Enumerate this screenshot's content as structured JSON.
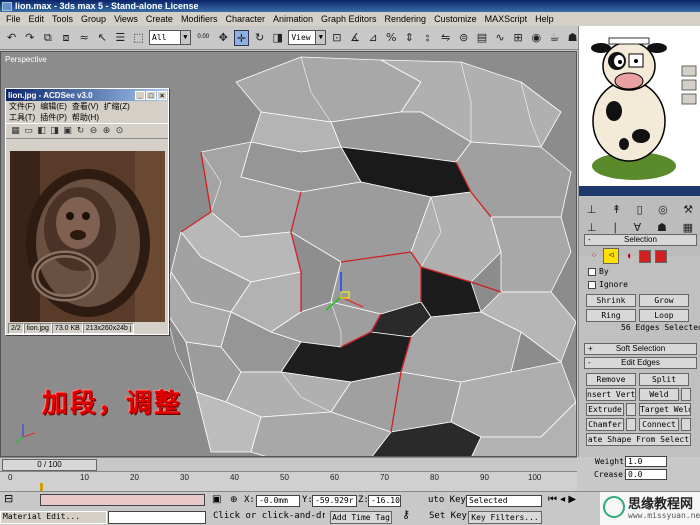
{
  "window": {
    "title": "lion.max - 3ds max 5 - Stand-alone License"
  },
  "menu": [
    "File",
    "Edit",
    "Tools",
    "Group",
    "Views",
    "Create",
    "Modifiers",
    "Character",
    "Animation",
    "Graph Editors",
    "Rendering",
    "Customize",
    "MAXScript",
    "Help"
  ],
  "toolbar": {
    "selection_filter": "All",
    "mini_value": "0.00",
    "reference_coord": "View",
    "active_tool": "move"
  },
  "viewport": {
    "label": "Perspective"
  },
  "acdsee": {
    "title": "lion.jpg - ACDSee v3.0",
    "menu_row1": [
      "文件(F)",
      "编辑(E)",
      "查看(V)",
      "扩缩(Z)"
    ],
    "menu_row2": [
      "工具(T)",
      "插件(P)",
      "帮助(H)"
    ],
    "status": {
      "index": "2/2",
      "filename": "lion.jpg",
      "size": "73.0 KB",
      "dims": "213x260x24b j"
    }
  },
  "caption": "加段，调整",
  "panel": {
    "selection_title": "Selection",
    "by_label": "By",
    "ignore_label": "Ignore",
    "shrink": "Shrink",
    "grow": "Grow",
    "ring": "Ring",
    "loop": "Loop",
    "selected_count": "56 Edges Selected",
    "soft_selection": "Soft Selection",
    "edit_edges": "Edit Edges",
    "remove": "Remove",
    "split": "Split",
    "insert_vertex": "nsert Verte",
    "weld": "Weld",
    "extrude": "Extrude",
    "target_weld": "Target Weld",
    "chamfer": "Chamfer",
    "connect": "Connect",
    "create_shape": "ate Shape From Select",
    "weight_label": "Weight:",
    "weight_value": "1.0",
    "crease_label": "Crease:",
    "crease_value": "0.0"
  },
  "timeline": {
    "frame": "0 / 100",
    "ticks": [
      "0",
      "10",
      "20",
      "30",
      "40",
      "50",
      "60",
      "70",
      "80",
      "90",
      "100"
    ]
  },
  "status": {
    "material_editor": "Material Edit...",
    "prompt": "Click or click-and-drag",
    "x_label": "X:",
    "x_value": "-0.0mm",
    "y_label": "Y:",
    "y_value": "-59.929r",
    "z_label": "Z:",
    "z_value": "-16.10:",
    "add_time_tag": "Add Time Tag",
    "auto_key": "uto Key",
    "key_mode": "Selected",
    "set_key": "Set Key",
    "key_filters": "Key Filters..."
  },
  "watermark": {
    "line1": "思缘教程网",
    "line2": "www.missyuan.net"
  },
  "colors": {
    "viewport_bg": "#8c8c8c",
    "mesh_face": "#a0a0a0",
    "selected_edge": "#cc2020",
    "caption": "#e00000"
  }
}
